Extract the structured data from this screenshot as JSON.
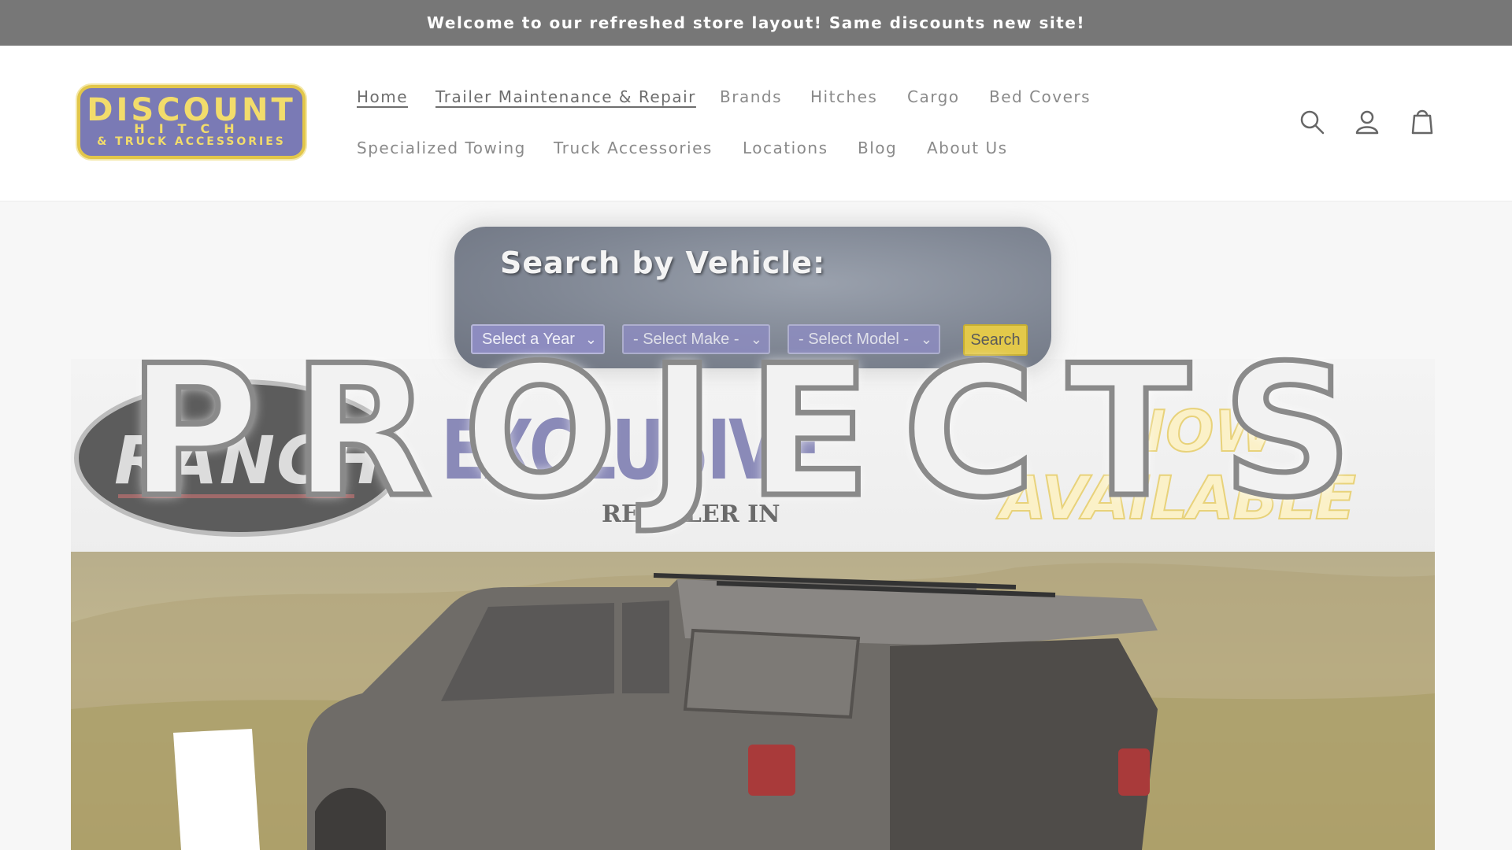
{
  "announcement": "Welcome to our refreshed store layout! Same discounts new site!",
  "logo": {
    "main": "DISCOUNT",
    "line2": "HITCH",
    "line3": "& TRUCK ACCESSORIES"
  },
  "nav": {
    "row1": [
      "Home",
      "Trailer Maintenance & Repair",
      "Brands",
      "Hitches",
      "Cargo",
      "Bed Covers"
    ],
    "row2": [
      "Specialized Towing",
      "Truck Accessories",
      "Locations",
      "Blog",
      "About Us"
    ]
  },
  "header_icons": [
    "search-icon",
    "account-icon",
    "cart-icon"
  ],
  "vehicle_search": {
    "title": "Search by Vehicle:",
    "year": "Select a Year",
    "make": "- Select Make -",
    "model": "- Select Model -",
    "button": "Search"
  },
  "banner": {
    "brand": "RANCH",
    "exclusive": "EXCLUSIVE",
    "retailer": "RETAILER IN",
    "now": "NOW",
    "available": "AVAILABLE"
  },
  "overlay_title": "PROJECTS",
  "colors": {
    "announcement_bg": "#777777",
    "logo_bg": "#7a7ab5",
    "logo_accent": "#e2c64a",
    "select_bg": "#8d8cc0",
    "search_button": "#e3c94a"
  }
}
